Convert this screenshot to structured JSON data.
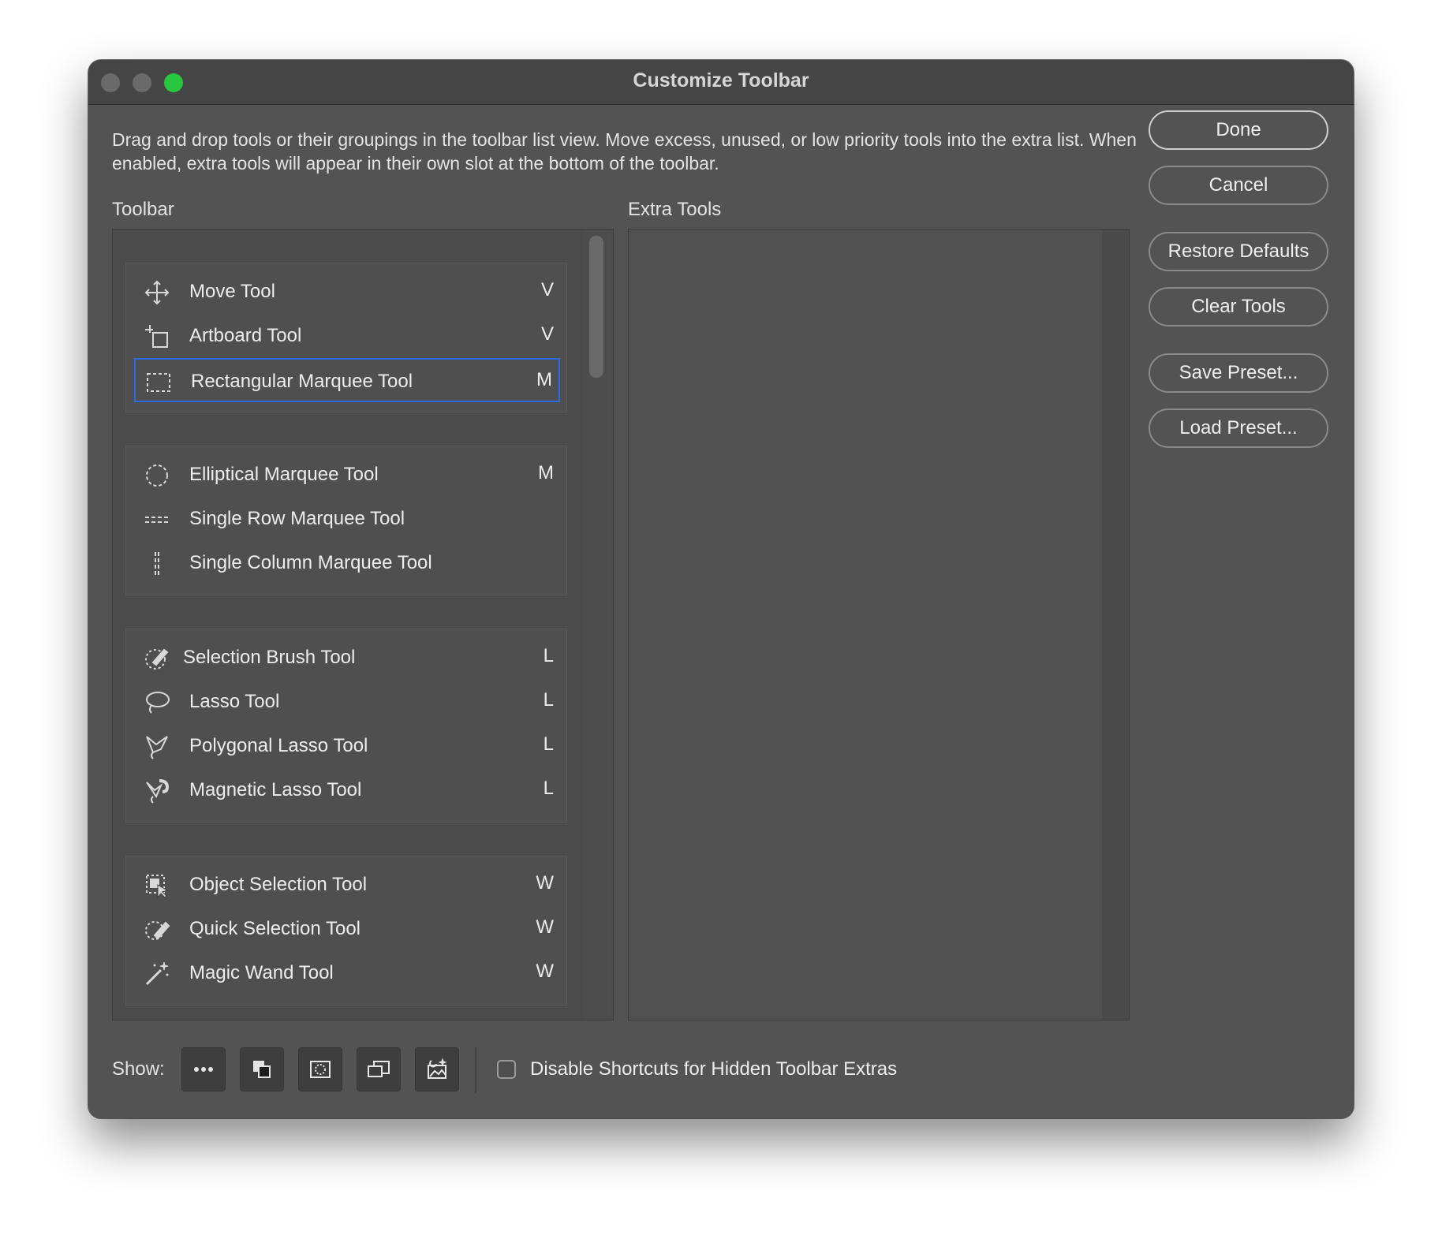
{
  "window": {
    "title": "Customize Toolbar",
    "instructions": "Drag and drop tools or their groupings in the toolbar list view. Move excess, unused, or low priority tools into the extra list. When enabled, extra tools will appear in their own slot at the bottom of the toolbar."
  },
  "toolbar_label": "Toolbar",
  "extra_label": "Extra Tools",
  "groups": [
    {
      "tools": [
        {
          "name": "Move Tool",
          "key": "V",
          "icon": "move-icon"
        },
        {
          "name": "Artboard Tool",
          "key": "V",
          "icon": "artboard-icon"
        },
        {
          "name": "Rectangular Marquee Tool",
          "key": "M",
          "icon": "rect-marquee-icon",
          "selected": true
        }
      ]
    },
    {
      "tools": [
        {
          "name": "Elliptical Marquee Tool",
          "key": "M",
          "icon": "ellipse-marquee-icon"
        },
        {
          "name": "Single Row Marquee Tool",
          "key": "",
          "icon": "single-row-marquee-icon"
        },
        {
          "name": "Single Column Marquee Tool",
          "key": "",
          "icon": "single-column-marquee-icon"
        }
      ]
    },
    {
      "tools": [
        {
          "name": "Selection Brush Tool",
          "key": "L",
          "icon": "selection-brush-icon"
        },
        {
          "name": "Lasso Tool",
          "key": "L",
          "icon": "lasso-icon"
        },
        {
          "name": "Polygonal Lasso Tool",
          "key": "L",
          "icon": "polygonal-lasso-icon"
        },
        {
          "name": "Magnetic Lasso Tool",
          "key": "L",
          "icon": "magnetic-lasso-icon"
        }
      ]
    },
    {
      "tools": [
        {
          "name": "Object Selection Tool",
          "key": "W",
          "icon": "object-selection-icon"
        },
        {
          "name": "Quick Selection Tool",
          "key": "W",
          "icon": "quick-selection-icon"
        },
        {
          "name": "Magic Wand Tool",
          "key": "W",
          "icon": "magic-wand-icon"
        }
      ]
    }
  ],
  "buttons": {
    "done": "Done",
    "cancel": "Cancel",
    "restore_defaults": "Restore Defaults",
    "clear_tools": "Clear Tools",
    "save_preset": "Save Preset...",
    "load_preset": "Load Preset..."
  },
  "bottom": {
    "show_label": "Show:",
    "show_buttons": [
      "more-icon",
      "color-swatches-icon",
      "quick-mask-icon",
      "screen-mode-icon",
      "content-aware-icon"
    ],
    "disable_shortcuts_label": "Disable Shortcuts for Hidden Toolbar Extras",
    "disable_shortcuts_checked": false
  },
  "colors": {
    "accent_selection": "#2b6ae0",
    "traffic_green": "#29c73f"
  }
}
